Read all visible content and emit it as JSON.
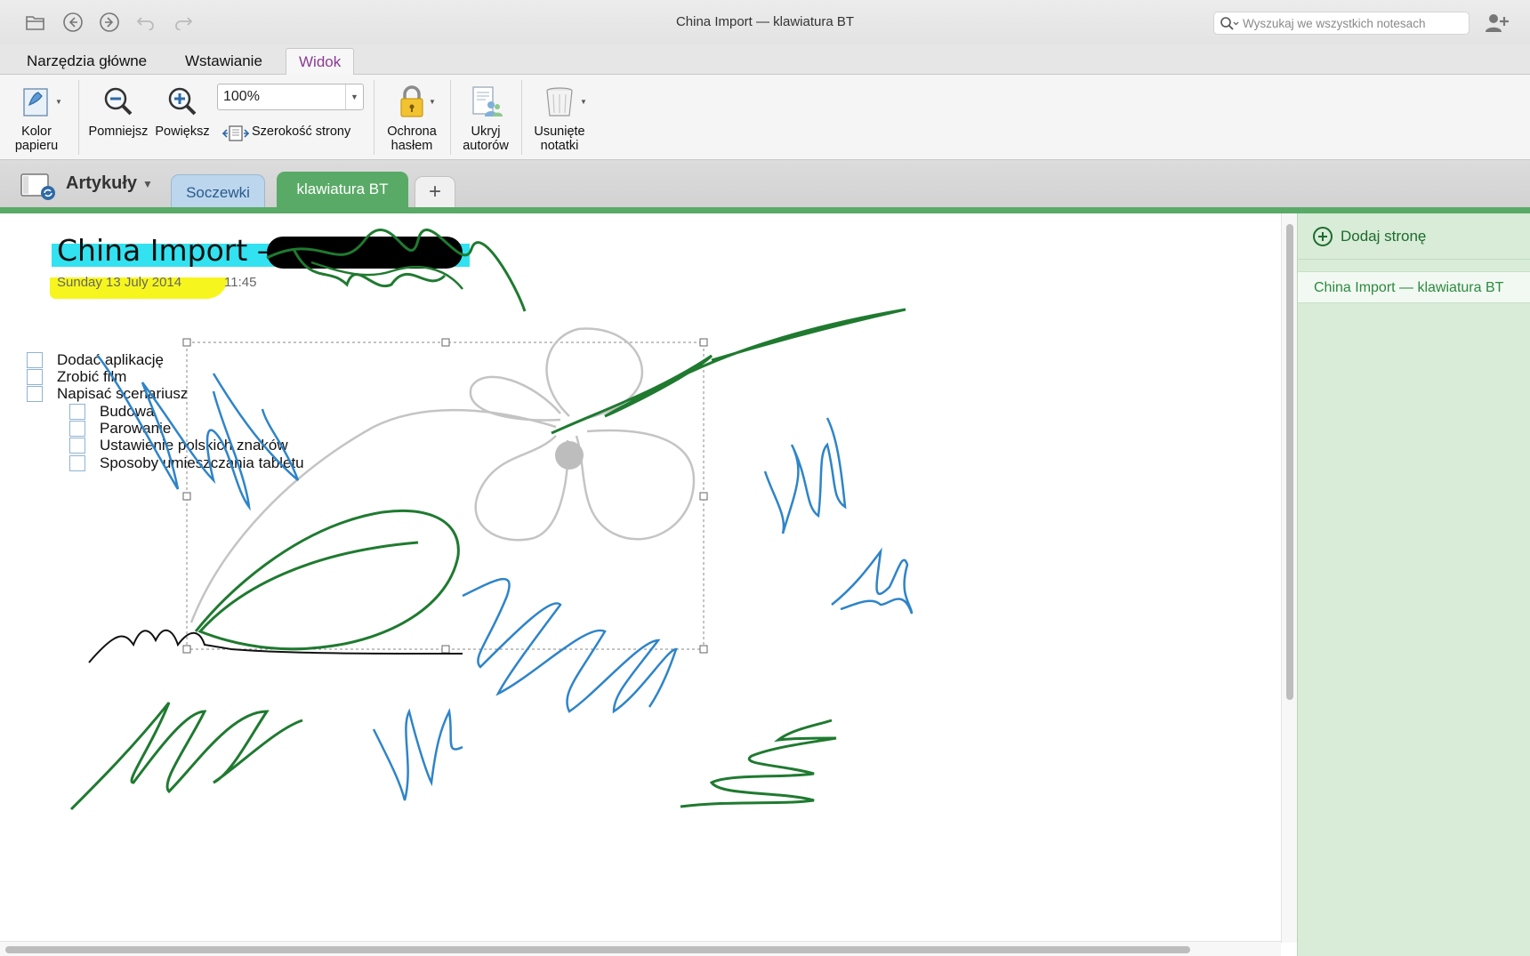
{
  "window": {
    "title": "China Import — klawiatura BT",
    "search_placeholder": "Wyszukaj we wszystkich notesach"
  },
  "ribbon_tabs": [
    {
      "label": "Narzędzia główne",
      "active": false
    },
    {
      "label": "Wstawianie",
      "active": false
    },
    {
      "label": "Widok",
      "active": true
    }
  ],
  "ribbon": {
    "paper_color": "Kolor papieru",
    "zoom_out": "Pomniejsz",
    "zoom_in": "Powiększ",
    "zoom_value": "100%",
    "page_width": "Szerokość strony",
    "password": "Ochrona hasłem",
    "hide_authors": "Ukryj autorów",
    "deleted_notes": "Usunięte notatki"
  },
  "notebook": {
    "name": "Artykuły",
    "sections": [
      {
        "label": "Soczewki",
        "color": "#bcd6ee"
      },
      {
        "label": "klawiatura BT",
        "color": "#5aaa67",
        "active": true
      }
    ],
    "add_section": "+"
  },
  "page": {
    "title": "China Import — ",
    "date": "Sunday 13 July 2014",
    "time": "11:45",
    "todos": [
      {
        "label": "Dodać aplikację",
        "level": 0
      },
      {
        "label": "Zrobić film",
        "level": 0
      },
      {
        "label": "Napisać scenariusz",
        "level": 0
      },
      {
        "label": "Budowa",
        "level": 1
      },
      {
        "label": "Parowanie",
        "level": 1
      },
      {
        "label": "Ustawienie polskich znaków",
        "level": 1
      },
      {
        "label": "Sposoby umieszczania tabletu",
        "level": 1
      }
    ]
  },
  "sidebar": {
    "add_page": "Dodaj stronę",
    "pages": [
      "China Import — klawiatura BT"
    ]
  },
  "colors": {
    "accent_green": "#5aaa67",
    "ribbon_active_tab": "#8b3a95",
    "ink_blue": "#2e84c8",
    "ink_green": "#1f7a30",
    "highlight_cyan": "#32e2f0",
    "highlight_yellow": "#f6f61e"
  },
  "icons": [
    "folder-icon",
    "back-icon",
    "forward-icon",
    "undo-icon",
    "redo-icon",
    "search-icon",
    "share-icon",
    "smiley-icon",
    "collapse-ribbon-icon",
    "paper-color-icon",
    "zoom-out-icon",
    "zoom-in-icon",
    "page-width-icon",
    "lock-icon",
    "authors-icon",
    "trash-icon",
    "notebook-icon"
  ]
}
